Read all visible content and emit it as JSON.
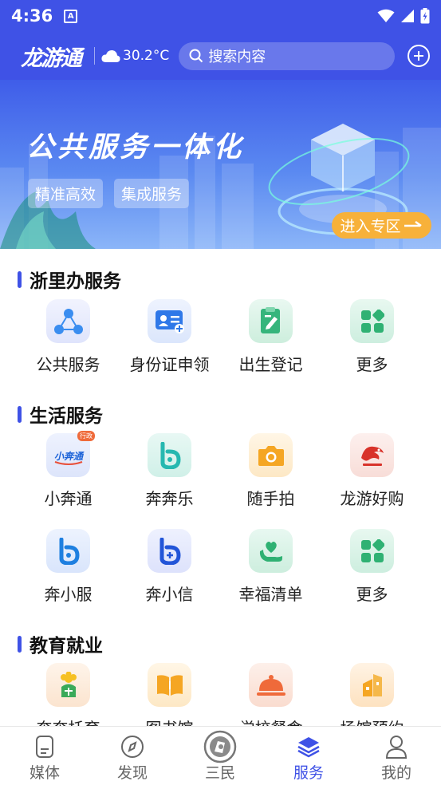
{
  "status_bar": {
    "time": "4:36",
    "badge": "A"
  },
  "header": {
    "logo": "龙游通",
    "temperature": "30.2°C",
    "search_placeholder": "搜索内容",
    "weather_icon": "cloud-icon",
    "add_icon": "plus-circle-icon"
  },
  "banner": {
    "title": "公共服务一体化",
    "tags": [
      "精准高效",
      "集成服务"
    ],
    "enter_label": "进入专区"
  },
  "sections": [
    {
      "title": "浙里办服务",
      "items": [
        {
          "label": "公共服务",
          "icon": "network-icon"
        },
        {
          "label": "身份证申领",
          "icon": "id-card-icon"
        },
        {
          "label": "出生登记",
          "icon": "register-icon"
        },
        {
          "label": "更多",
          "icon": "grid-icon"
        }
      ]
    },
    {
      "title": "生活服务",
      "items": [
        {
          "label": "小奔通",
          "icon": "xiaobentong-logo-icon",
          "badge": "行政"
        },
        {
          "label": "奔奔乐",
          "icon": "benbenle-icon"
        },
        {
          "label": "随手拍",
          "icon": "camera-icon"
        },
        {
          "label": "龙游好购",
          "icon": "dragon-shop-icon"
        },
        {
          "label": "奔小服",
          "icon": "benxiaofu-icon"
        },
        {
          "label": "奔小信",
          "icon": "benxiaoxin-icon"
        },
        {
          "label": "幸福清单",
          "icon": "heart-phone-icon"
        },
        {
          "label": "更多",
          "icon": "grid-icon"
        }
      ]
    },
    {
      "title": "教育就业",
      "items": [
        {
          "label": "奔奔托育",
          "icon": "childcare-icon"
        },
        {
          "label": "图书馆",
          "icon": "book-icon"
        },
        {
          "label": "学校餐食",
          "icon": "meal-icon"
        },
        {
          "label": "场馆预约",
          "icon": "venue-icon"
        }
      ]
    }
  ],
  "tabbar": [
    {
      "label": "媒体",
      "icon": "media-icon"
    },
    {
      "label": "发现",
      "icon": "compass-icon"
    },
    {
      "label": "三民",
      "icon": "sanmin-icon"
    },
    {
      "label": "服务",
      "icon": "layers-icon",
      "active": true
    },
    {
      "label": "我的",
      "icon": "user-icon"
    }
  ],
  "colors": {
    "primary": "#3f52e6",
    "accent_orange": "#f7b13a",
    "active_tab": "#3f52e6"
  }
}
